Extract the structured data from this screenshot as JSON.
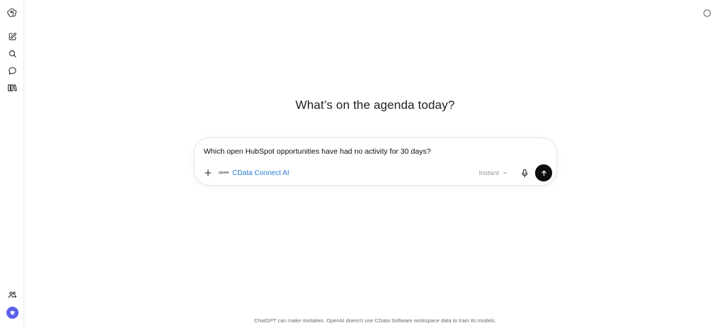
{
  "main": {
    "heading": "What’s on the agenda today?"
  },
  "composer": {
    "prompt_value": "Which open HubSpot opportunities have had no activity for 30 days?",
    "connector": {
      "logo_text": "CDATA",
      "label": "CData Connect AI"
    },
    "mode_label": "Instant"
  },
  "footer": {
    "disclaimer": "ChatGPT can make mistakes. OpenAI doesn't use CData Software workspace data to train its models."
  },
  "icons": {
    "logo": "openai-logo-icon",
    "new_chat": "new-chat-icon",
    "search": "search-icon",
    "chats": "chat-bubble-icon",
    "library": "library-icon",
    "invite": "invite-members-icon",
    "temporary_chat": "temporary-chat-icon"
  },
  "colors": {
    "connector_link": "#2a7fd4",
    "avatar_bg": "#5a61e8",
    "send_bg": "#0d0d0d"
  }
}
